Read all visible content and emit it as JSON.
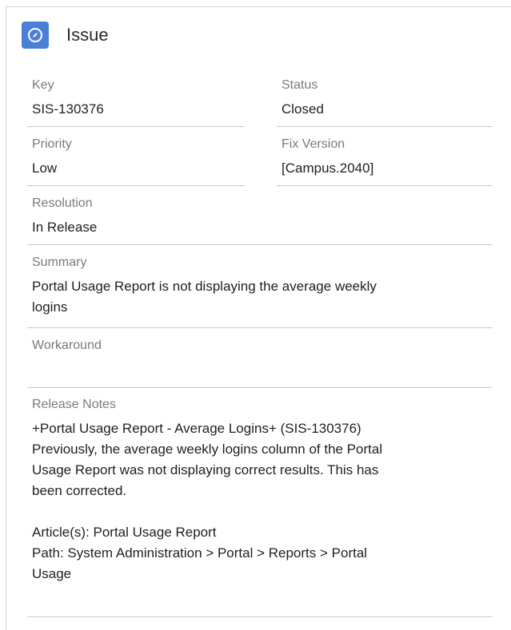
{
  "header": {
    "title": "Issue",
    "icon": "compass-icon",
    "icon_color": "#4a7fd8"
  },
  "fields": {
    "key": {
      "label": "Key",
      "value": "SIS-130376"
    },
    "status": {
      "label": "Status",
      "value": "Closed"
    },
    "priority": {
      "label": "Priority",
      "value": "Low"
    },
    "fix_version": {
      "label": "Fix Version",
      "value": "[Campus.2040]"
    },
    "resolution": {
      "label": "Resolution",
      "value": "In Release"
    },
    "summary": {
      "label": "Summary",
      "value": "Portal Usage Report is not displaying the average weekly\nlogins"
    },
    "workaround": {
      "label": "Workaround",
      "value": ""
    },
    "release_notes": {
      "label": "Release Notes",
      "value": "+Portal Usage Report - Average Logins+ (SIS-130376)\nPreviously, the average weekly logins column of the Portal\nUsage Report was not displaying correct results. This has\nbeen corrected.\n\nArticle(s): Portal Usage Report\nPath: System Administration > Portal > Reports > Portal\nUsage"
    }
  }
}
